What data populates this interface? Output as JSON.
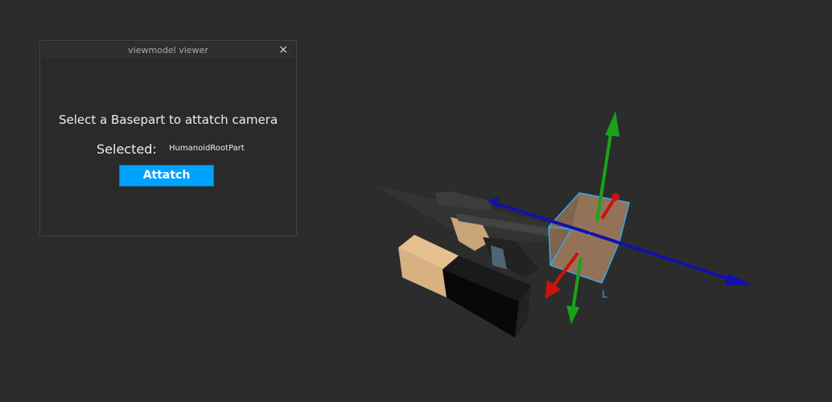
{
  "window": {
    "title": "viewmodel viewer",
    "close_glyph": "×"
  },
  "content": {
    "prompt": "Select a Basepart to attatch camera",
    "selected_label": "Selected:",
    "selected_value": "HumanoidRootPart",
    "attach_label": "Attatch"
  },
  "viewport": {
    "part_label": "L"
  },
  "colors": {
    "background": "#2c2c2c",
    "accent": "#00a2ff",
    "axis_x": "#cc1111",
    "axis_y": "#1aa31a",
    "axis_z": "#1111aa",
    "selection": "#38a8e8"
  }
}
